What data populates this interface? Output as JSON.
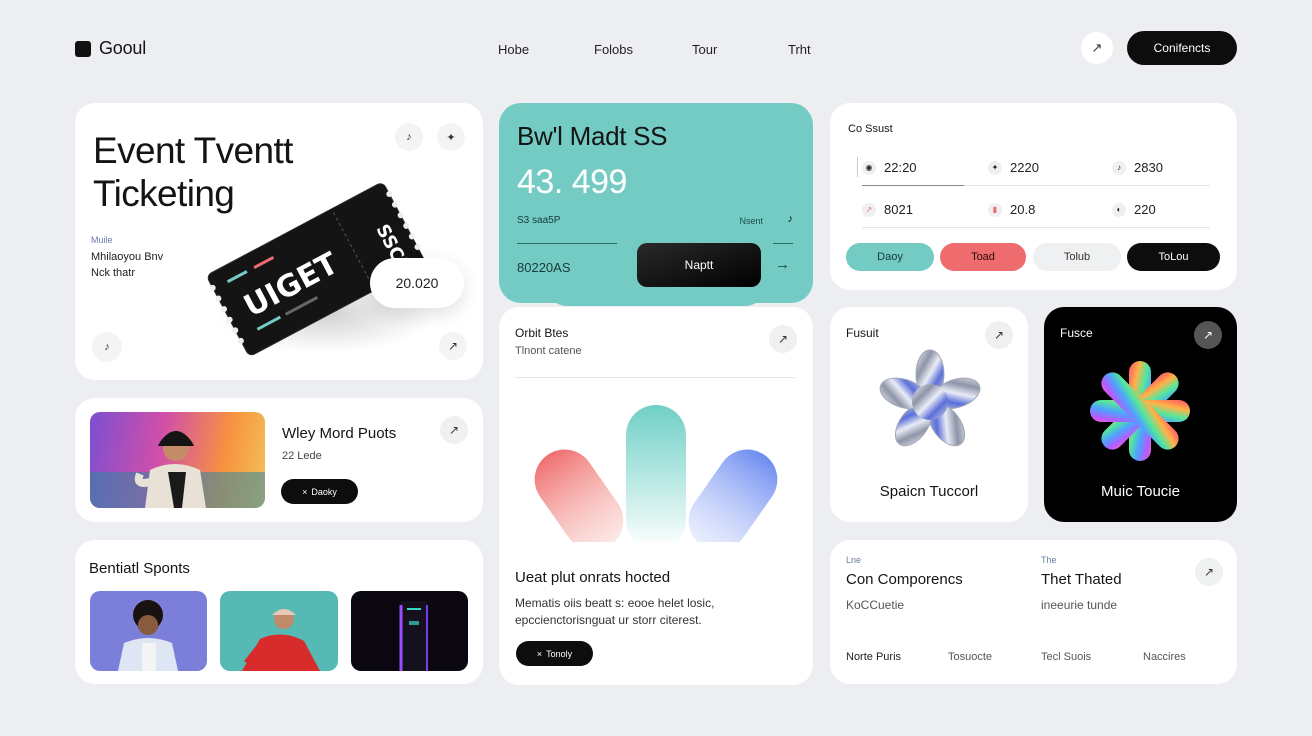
{
  "brand": {
    "name": "Gooul"
  },
  "nav": {
    "links": [
      "Hobe",
      "Folobs",
      "Tour",
      "Trht"
    ],
    "cta": "Conifencts"
  },
  "hero": {
    "title": "Event Tventt Ticketing",
    "meta": [
      "Muile",
      "Mhilaoyou Bnv",
      "Nck thatr"
    ],
    "price": "20.020",
    "ticket_text": [
      "UIGET",
      "SSCE"
    ]
  },
  "promo": {
    "title": "Bw'l Madt SS",
    "amount": "43. 499",
    "label_left": "S3 saa5P",
    "label_right": "Nsent",
    "code": "80220ΑS",
    "button": "Naptt"
  },
  "schedule": {
    "title": "Co Ssust",
    "times": [
      [
        "22:20",
        "2220",
        "2830"
      ],
      [
        "8021",
        "20.8",
        "220"
      ]
    ],
    "tabs": [
      "Daoy",
      "Toad",
      "Tolub",
      "ToLou"
    ]
  },
  "artist": {
    "name": "Wley Mord Puots",
    "subtitle": "22 Lede",
    "button": "Daoky"
  },
  "featured": {
    "title": "Orbit Btes",
    "subtitle": "Tlnont catene",
    "headline": "Ueat plut onrats hocted",
    "body": "Mematis oiis beatt s: eooe helet losic, epccienctorisnguat ur storr citerest.",
    "button": "Tonoly"
  },
  "sports": {
    "title": "Bentiatl Sponts"
  },
  "tile_a": {
    "tag": "Fusuit",
    "name": "Spaicn Tuccorl"
  },
  "tile_b": {
    "tag": "Fusce",
    "name": "Muic Toucie"
  },
  "conference": {
    "col1_tag": "Lne",
    "col1_title": "Con Comporencs",
    "col1_sub": "KoCCuetie",
    "col2_tag": "The",
    "col2_title": "Thet Thated",
    "col2_sub": "ineeurie tunde",
    "links": [
      "Norte Puris",
      "Tosuocte",
      "Tecl Suois",
      "Naccires"
    ]
  },
  "colors": {
    "teal": "#74cbc4",
    "coral": "#ee6b6e",
    "dark": "#0d0d0d",
    "background": "#eceef1"
  }
}
